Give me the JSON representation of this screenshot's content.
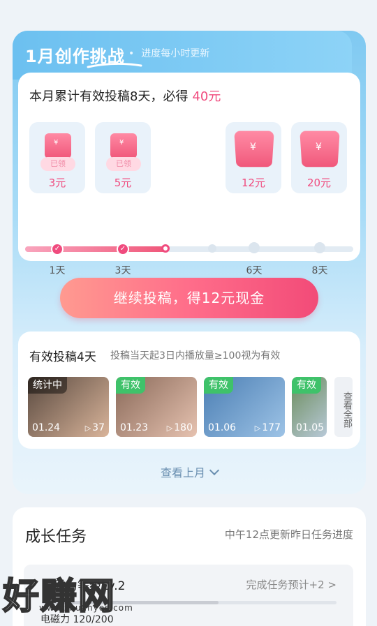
{
  "challenge": {
    "title": "1月创作挑战",
    "subtitle": "进度每小时更新",
    "reward_text": "本月累计有效投稿8天，必得",
    "reward_amount": "40元",
    "rewards": [
      {
        "value": "3元",
        "tag": "已领",
        "day": "1天"
      },
      {
        "value": "5元",
        "tag": "已领",
        "day": "3天"
      },
      {
        "value": "12元",
        "tag": "",
        "day": "6天"
      },
      {
        "value": "20元",
        "tag": "",
        "day": "8天"
      }
    ],
    "progress": 0.43,
    "cta_label": "继续投稿，得12元现金",
    "posts_title": "有效投稿4天",
    "posts_note": "投稿当天起3日内播放量≥100视为有效",
    "posts": [
      {
        "status": "统计中",
        "date": "01.24",
        "plays": "37",
        "colors": [
          "#5a4a40",
          "#d9b49a"
        ]
      },
      {
        "status": "有效",
        "date": "01.23",
        "plays": "180",
        "colors": [
          "#8a6a5a",
          "#e6c2b0"
        ]
      },
      {
        "status": "有效",
        "date": "01.06",
        "plays": "177",
        "colors": [
          "#4c7fb4",
          "#9dc3e6"
        ]
      },
      {
        "status": "有效",
        "date": "01.05",
        "plays": "",
        "colors": [
          "#6a8c5a",
          "#b8c9d8"
        ]
      }
    ],
    "see_all": "查看全部",
    "last_month": "查看上月"
  },
  "growth": {
    "title": "成长任务",
    "note": "中午12点更新昨日任务进度",
    "task_name": "电磁力等级Lv.2",
    "task_estimate": "完成任务预计+2 >",
    "task_points": "电磁力 120/200",
    "task_progress": 0.6
  },
  "watermark": {
    "text": "好赚网",
    "url": "www.zhuanyes.com"
  }
}
